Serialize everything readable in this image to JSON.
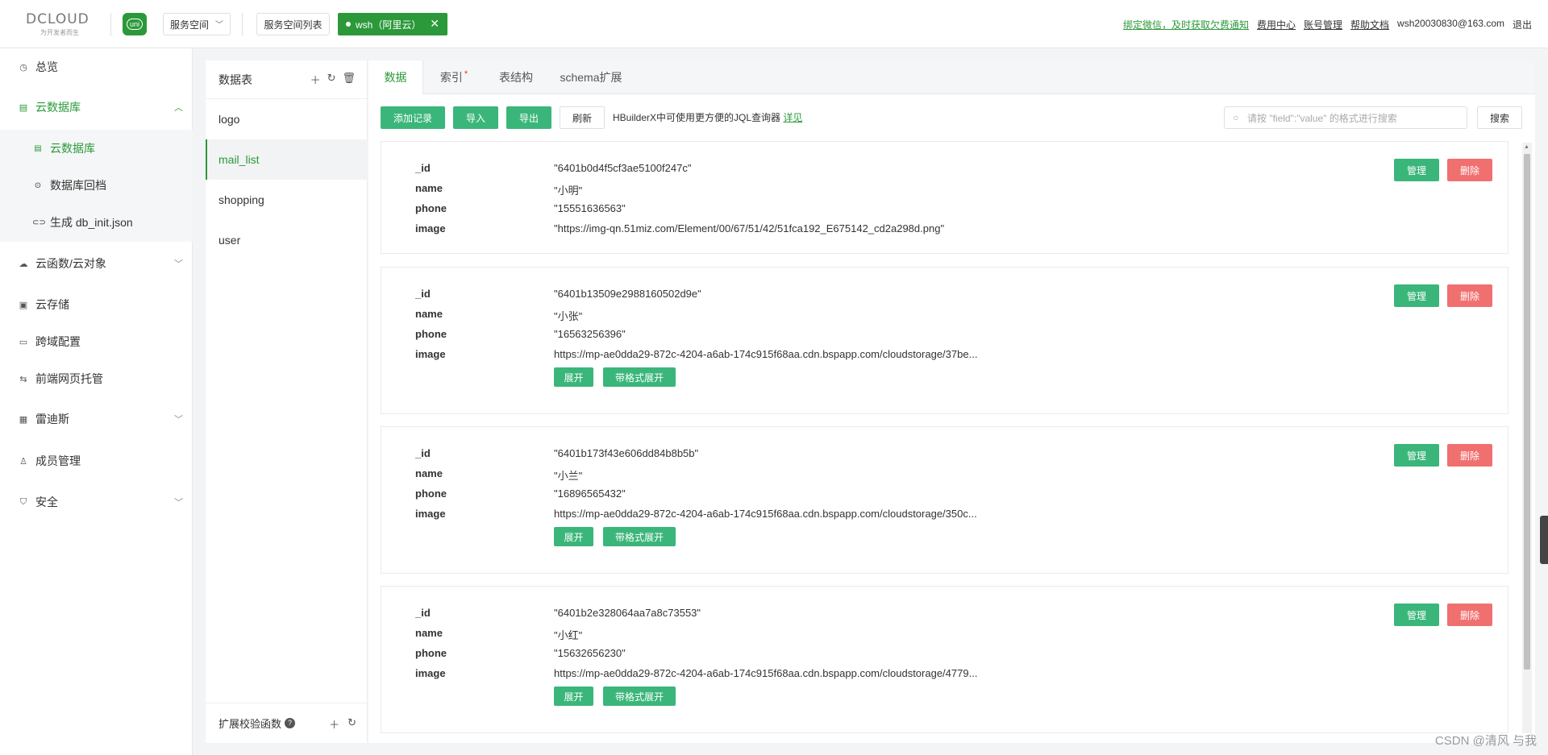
{
  "brand": {
    "name": "DCLOUD",
    "slogan": "为开发者而生",
    "uni": "uni"
  },
  "topbar": {
    "space_select": "服务空间",
    "space_list": "服务空间列表",
    "space_tag": "wsh（阿里云）",
    "close": "✕",
    "links": {
      "wechat": "绑定微信，及时获取欠费通知",
      "billing": "费用中心",
      "account": "账号管理",
      "help": "帮助文档",
      "email": "wsh20030830@163.com",
      "logout": "退出"
    }
  },
  "sidebar": {
    "overview": "总览",
    "cloud_db": "云数据库",
    "sub": {
      "db": "云数据库",
      "rollback": "数据库回档",
      "gen_init": "生成 db_init.json"
    },
    "cloud_func": "云函数/云对象",
    "storage": "云存储",
    "cors": "跨域配置",
    "hosting": "前端网页托管",
    "redis": "雷迪斯",
    "members": "成员管理",
    "security": "安全"
  },
  "tables": {
    "header": "数据表",
    "items": [
      "logo",
      "mail_list",
      "shopping",
      "user"
    ],
    "footer": "扩展校验函数",
    "q": "?"
  },
  "tabs": {
    "data": "数据",
    "index": "索引",
    "schema": "表结构",
    "schema_ext": "schema扩展",
    "star": "*"
  },
  "toolbar": {
    "add": "添加记录",
    "import": "导入",
    "export": "导出",
    "refresh": "刷新",
    "note": "HBuilderX中可使用更方便的JQL查询器",
    "note_link": "详见",
    "search_placeholder": "请按 \"field\":\"value\" 的格式进行搜索",
    "search": "搜索"
  },
  "records": [
    {
      "id": "\"6401b0d4f5cf3ae5100f247c\"",
      "name": "\"小明\"",
      "phone": "\"15551636563\"",
      "image": "\"https://img-qn.51miz.com/Element/00/67/51/42/51fca192_E675142_cd2a298d.png\""
    },
    {
      "id": "\"6401b13509e2988160502d9e\"",
      "name": "\"小张\"",
      "phone": "\"16563256396\"",
      "image": "https://mp-ae0dda29-872c-4204-a6ab-174c915f68aa.cdn.bspapp.com/cloudstorage/37be..."
    },
    {
      "id": "\"6401b173f43e606dd84b8b5b\"",
      "name": "\"小兰\"",
      "phone": "\"16896565432\"",
      "image": "https://mp-ae0dda29-872c-4204-a6ab-174c915f68aa.cdn.bspapp.com/cloudstorage/350c..."
    },
    {
      "id": "\"6401b2e328064aa7a8c73553\"",
      "name": "\"小红\"",
      "phone": "\"15632656230\"",
      "image": "https://mp-ae0dda29-872c-4204-a6ab-174c915f68aa.cdn.bspapp.com/cloudstorage/4779..."
    }
  ],
  "fields": {
    "id": "_id",
    "name": "name",
    "phone": "phone",
    "image": "image"
  },
  "record_actions": {
    "manage": "管理",
    "delete": "删除",
    "expand": "展开",
    "expand_fmt": "带格式展开"
  },
  "watermark": "CSDN @清风 与我"
}
